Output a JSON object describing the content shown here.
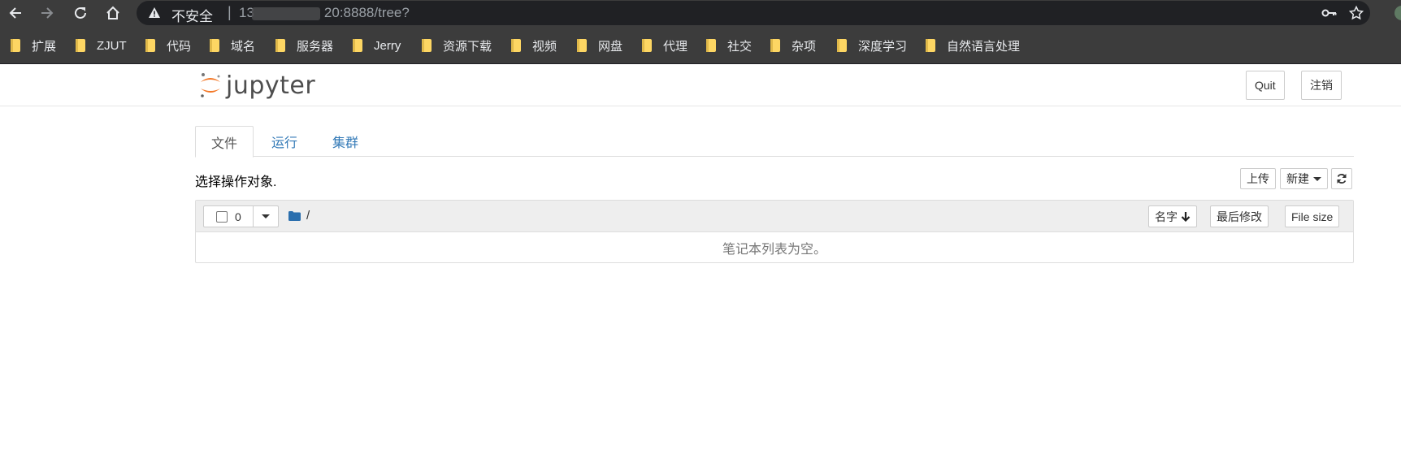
{
  "browser": {
    "insecure_label": "不安全",
    "separator": "|",
    "url_prefix": "13",
    "url_suffix": "20:8888/tree?",
    "bookmarks": [
      "扩展",
      "ZJUT",
      "代码",
      "域名",
      "服务器",
      "Jerry",
      "资源下载",
      "视频",
      "网盘",
      "代理",
      "社交",
      "杂项",
      "深度学习",
      "自然语言处理"
    ]
  },
  "header": {
    "logo_text": "jupyter",
    "quit_label": "Quit",
    "logout_label": "注销"
  },
  "tabs": [
    "文件",
    "运行",
    "集群"
  ],
  "toolbar": {
    "hint": "选择操作对象.",
    "upload_label": "上传",
    "new_label": "新建"
  },
  "list": {
    "selected_count": "0",
    "path": "/",
    "sort_name_label": "名字",
    "sort_modified_label": "最后修改",
    "sort_size_label": "File size",
    "empty_message": "笔记本列表为空。"
  },
  "colors": {
    "chrome_bg": "#3c3c3c",
    "link": "#337ab7",
    "logo_orange": "#f37726",
    "folder_icon": "#2b6fae"
  }
}
